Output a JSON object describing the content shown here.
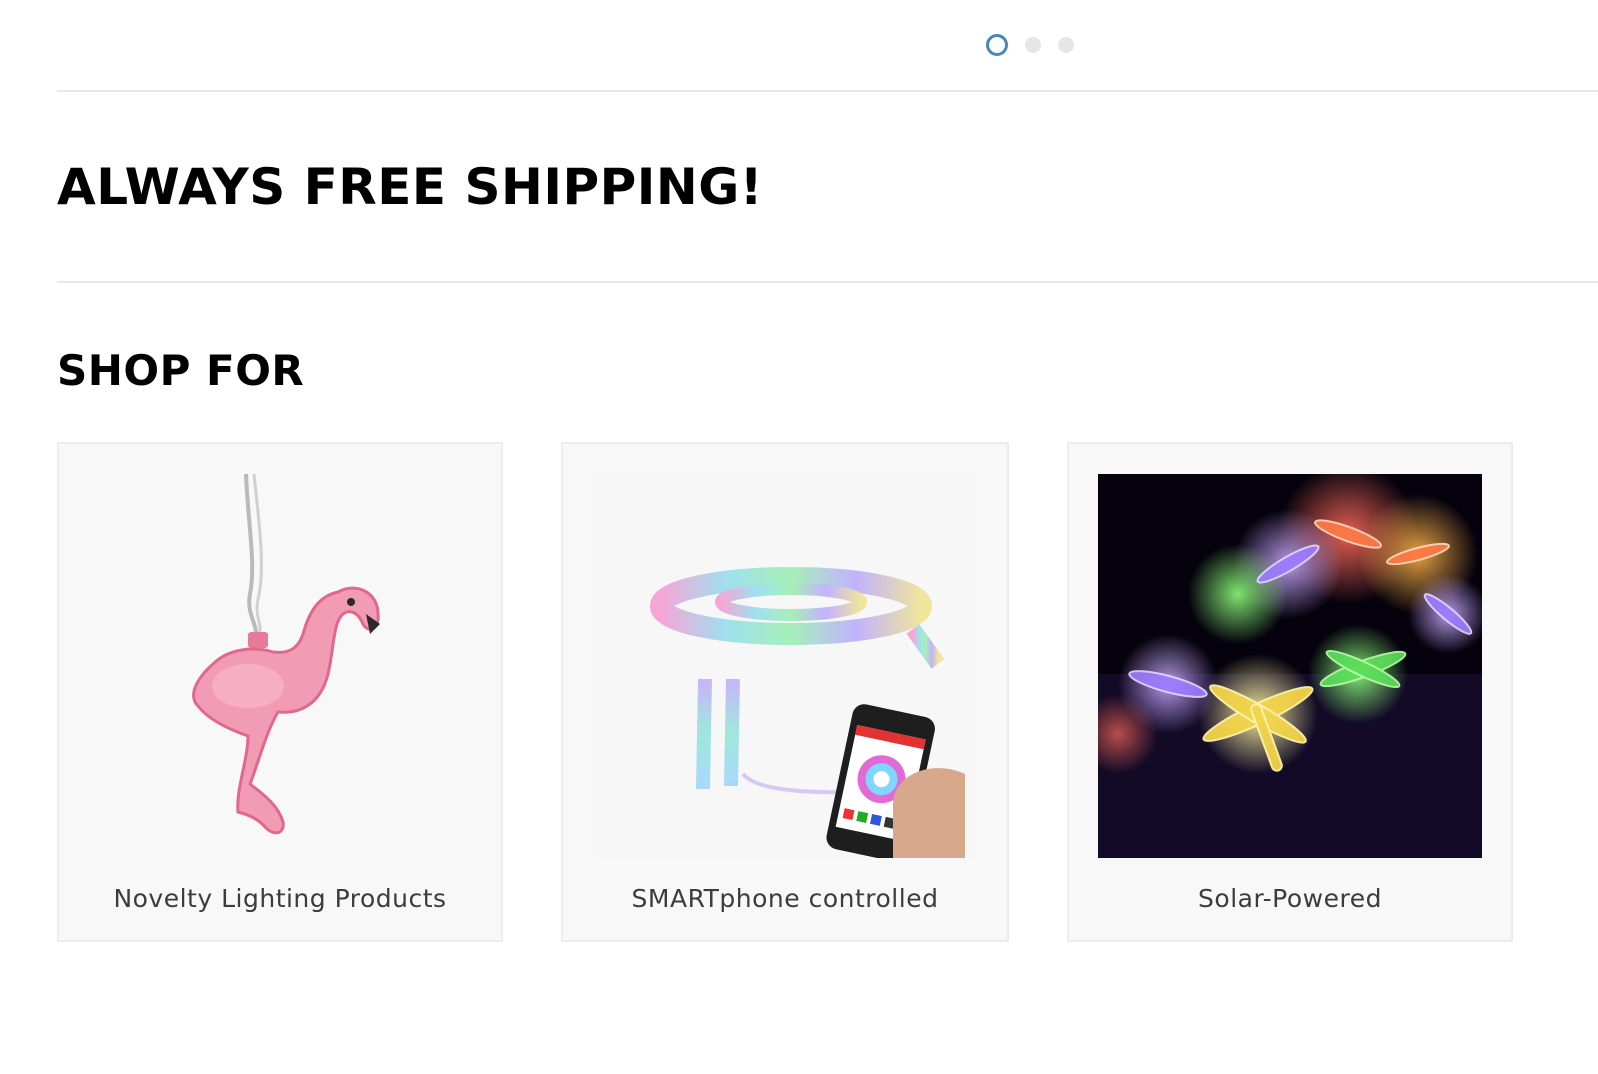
{
  "carousel": {
    "dots": [
      {
        "label": "slide-1",
        "active": true
      },
      {
        "label": "slide-2",
        "active": false
      },
      {
        "label": "slide-3",
        "active": false
      }
    ]
  },
  "banner": {
    "title": "ALWAYS FREE SHIPPING!"
  },
  "shop": {
    "title": "SHOP FOR",
    "categories": [
      {
        "label": "Novelty Lighting Products",
        "image": "flamingo-light-image"
      },
      {
        "label": "SMARTphone controlled",
        "image": "led-strip-phone-image"
      },
      {
        "label": "Solar-Powered",
        "image": "dragonfly-lights-image"
      }
    ]
  },
  "colors": {
    "accent": "#4a86b8",
    "divider": "#e9e9e9",
    "card_bg": "#f8f8f8"
  }
}
